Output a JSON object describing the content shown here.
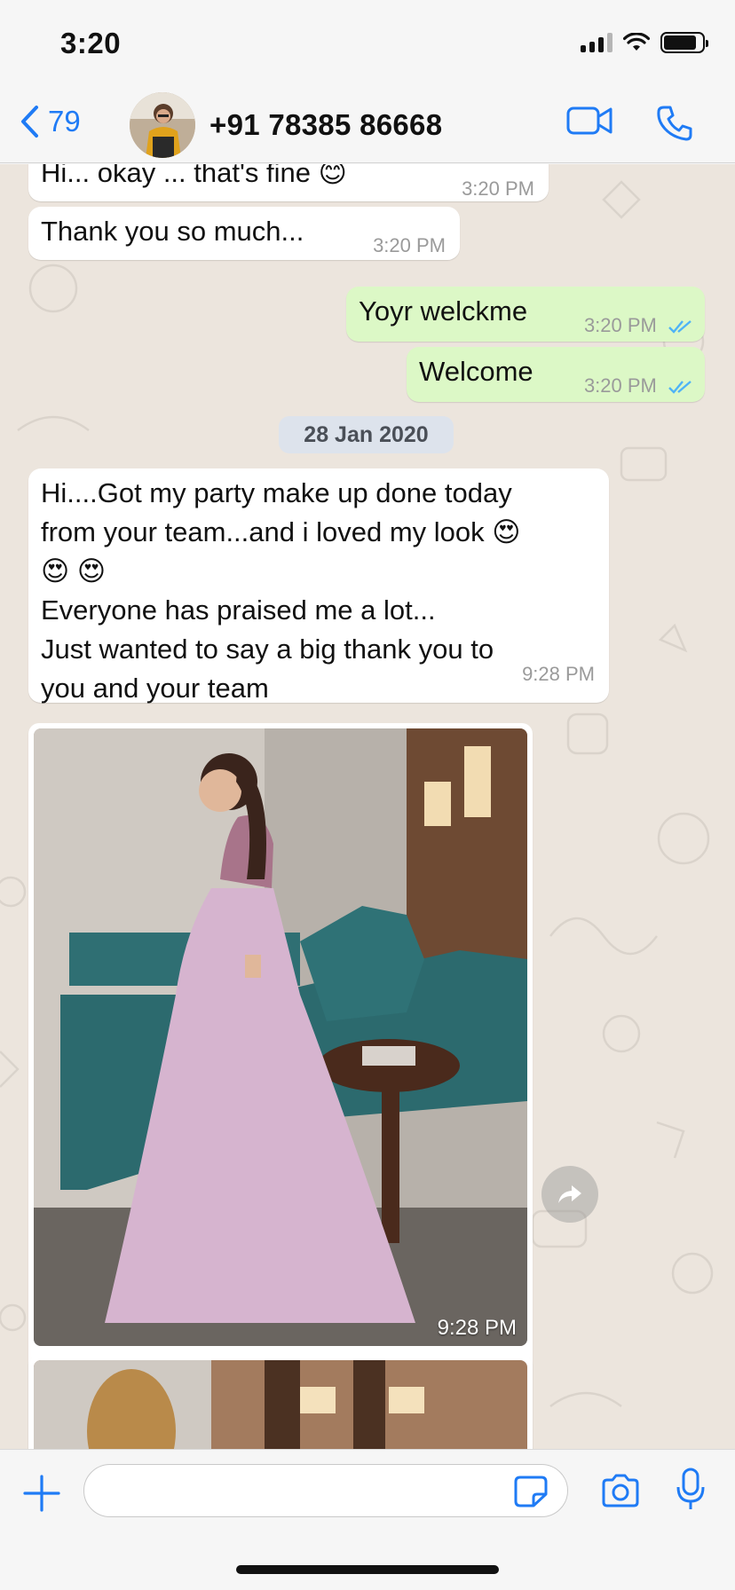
{
  "status_bar": {
    "time": "3:20"
  },
  "header": {
    "back_count": "79",
    "contact_name": "+91 78385 86668"
  },
  "messages": [
    {
      "direction": "in",
      "text": "Hi... okay ... that's fine 😊",
      "time": "3:20 PM"
    },
    {
      "direction": "in",
      "text": "Thank you so much...",
      "time": "3:20 PM"
    },
    {
      "direction": "out",
      "text": "Yoyr welckme",
      "time": "3:20 PM",
      "status": "read"
    },
    {
      "direction": "out",
      "text": "Welcome",
      "time": "3:20 PM",
      "status": "read"
    },
    {
      "direction": "in",
      "lines": [
        "Hi....Got my party make up done  today",
        "from your team...and i loved my look 😍",
        "😍 😍",
        "Everyone has praised me a lot...",
        "Just wanted to say a big thank you to",
        "you and your team"
      ],
      "time": "9:28 PM"
    },
    {
      "direction": "in",
      "type": "photo",
      "time": "9:28 PM"
    },
    {
      "direction": "in",
      "type": "photo",
      "time": ""
    }
  ],
  "date_divider": "28 Jan 2020",
  "input": {
    "value": "",
    "placeholder": ""
  },
  "colors": {
    "accent": "#1f7bf5",
    "outgoing_bubble": "#dcf8c6",
    "incoming_bubble": "#ffffff",
    "chat_bg": "#ece5dd",
    "read_ticks": "#4fb3f6"
  }
}
